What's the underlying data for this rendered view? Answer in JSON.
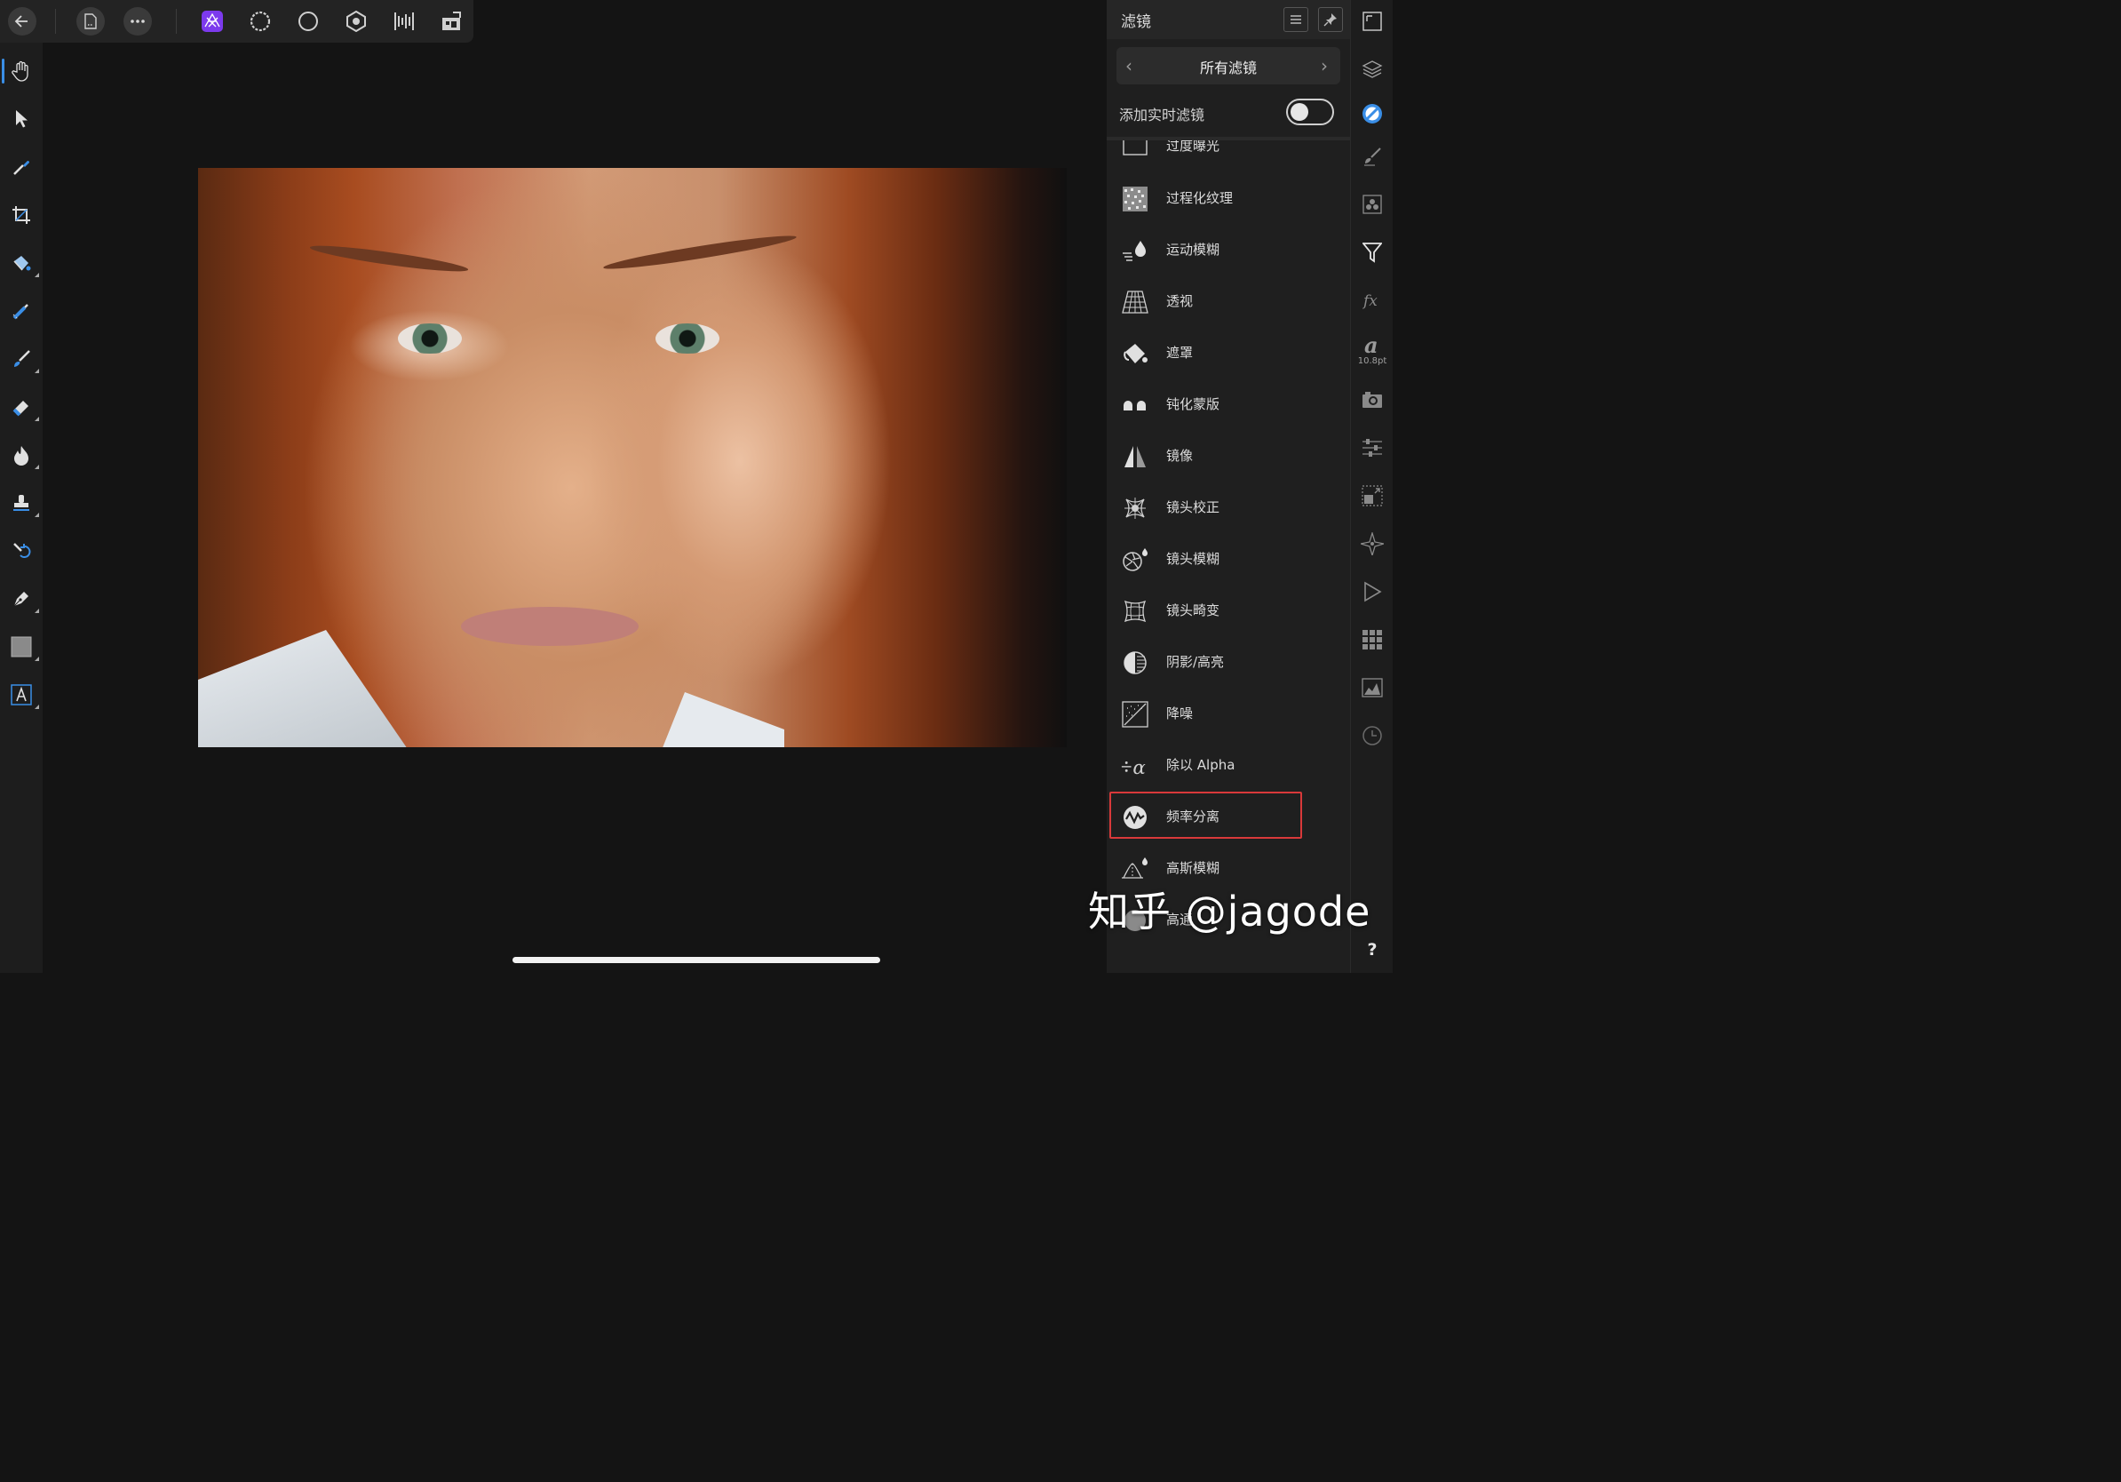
{
  "top_toolbar": {
    "back": "back-arrow-icon",
    "document": "document-icon",
    "more": "more-options-icon",
    "personas": [
      {
        "name": "photo-persona-icon",
        "active": true,
        "color": "#7c3aed"
      },
      {
        "name": "liquify-persona-icon",
        "active": false
      },
      {
        "name": "develop-persona-icon",
        "active": false
      },
      {
        "name": "tone-mapping-persona-icon",
        "active": false
      },
      {
        "name": "export-persona-icon",
        "active": false
      },
      {
        "name": "share-persona-icon",
        "active": false
      }
    ]
  },
  "left_tools": [
    "hand-tool-icon",
    "move-tool-icon",
    "color-picker-icon",
    "crop-tool-icon",
    "flood-fill-icon",
    "selection-brush-icon",
    "paint-brush-icon",
    "eraser-icon",
    "dodge-burn-icon",
    "clone-stamp-icon",
    "undo-brush-icon",
    "pen-tool-icon",
    "rectangle-tool-icon",
    "text-tool-icon"
  ],
  "filter_panel": {
    "title": "滤镜",
    "category": "所有滤镜",
    "live_filter_label": "添加实时滤镜",
    "live_filter_on": false,
    "items": [
      {
        "label": "过度曝光",
        "icon": "overexposure-icon"
      },
      {
        "label": "过程化纹理",
        "icon": "procedural-texture-icon"
      },
      {
        "label": "运动模糊",
        "icon": "motion-blur-icon"
      },
      {
        "label": "透视",
        "icon": "perspective-icon"
      },
      {
        "label": "遮罩",
        "icon": "mask-icon"
      },
      {
        "label": "钝化蒙版",
        "icon": "unsharp-mask-icon"
      },
      {
        "label": "镜像",
        "icon": "mirror-icon"
      },
      {
        "label": "镜头校正",
        "icon": "lens-correction-icon"
      },
      {
        "label": "镜头模糊",
        "icon": "lens-blur-icon"
      },
      {
        "label": "镜头畸变",
        "icon": "lens-distortion-icon"
      },
      {
        "label": "阴影/高亮",
        "icon": "shadows-highlights-icon"
      },
      {
        "label": "降噪",
        "icon": "denoise-icon"
      },
      {
        "label": "除以 Alpha",
        "icon": "divide-alpha-icon"
      },
      {
        "label": "频率分离",
        "icon": "frequency-separation-icon",
        "highlighted": true
      },
      {
        "label": "高斯模糊",
        "icon": "gaussian-blur-icon"
      },
      {
        "label": "高通",
        "icon": "high-pass-icon"
      }
    ],
    "highlight_color": "#d9393a"
  },
  "studio_bar": {
    "font_size_label": "10.8pt",
    "help": "?"
  },
  "watermark": "知乎 @jagode"
}
